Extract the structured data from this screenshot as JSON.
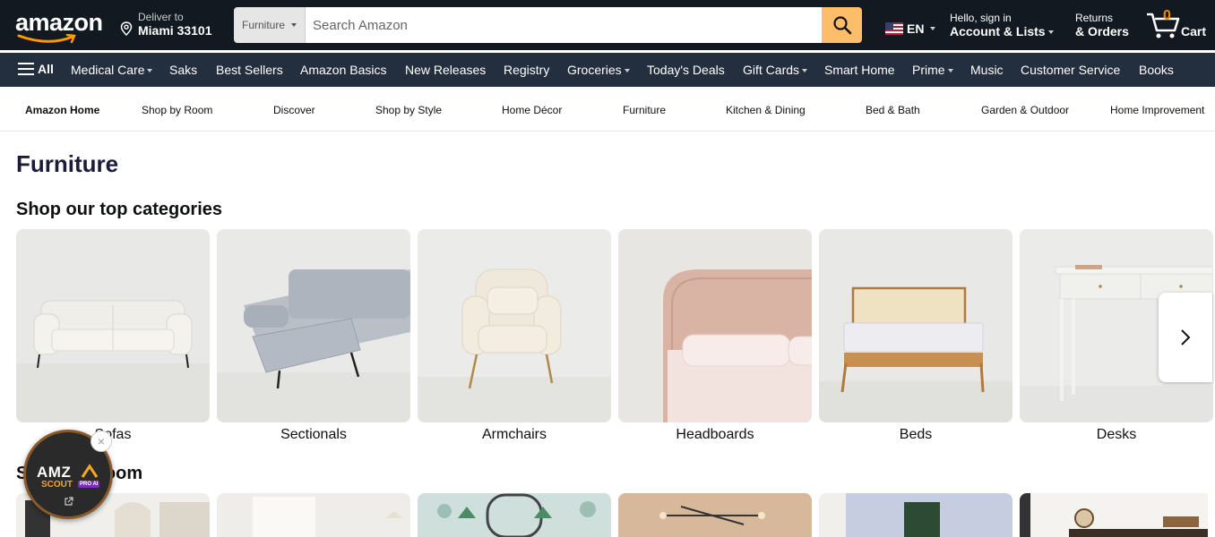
{
  "header": {
    "logo_text": "amazon",
    "deliver_line1": "Deliver to",
    "deliver_line2": "Miami 33101",
    "search_category": "Furniture",
    "search_placeholder": "Search Amazon",
    "language": "EN",
    "account_line1": "Hello, sign in",
    "account_line2": "Account & Lists",
    "returns_line1": "Returns",
    "returns_line2": "& Orders",
    "cart_count": "0",
    "cart_label": "Cart"
  },
  "nav": {
    "all_label": "All",
    "items": [
      "Medical Care",
      "Saks",
      "Best Sellers",
      "Amazon Basics",
      "New Releases",
      "Registry",
      "Groceries",
      "Today's Deals",
      "Gift Cards",
      "Smart Home",
      "Prime",
      "Music",
      "Customer Service",
      "Books"
    ]
  },
  "subnav": {
    "items": [
      "Amazon Home",
      "Shop by Room",
      "Discover",
      "Shop by Style",
      "Home Décor",
      "Furniture",
      "Kitchen & Dining",
      "Bed & Bath",
      "Garden & Outdoor",
      "Home Improvement"
    ]
  },
  "page": {
    "title": "Furniture",
    "categories_heading": "Shop our top categories",
    "room_heading": "Shop by Room"
  },
  "categories": [
    "Sofas",
    "Sectionals",
    "Armchairs",
    "Headboards",
    "Beds",
    "Desks"
  ],
  "widget": {
    "line1": "AMZ",
    "line2": "SCOUT",
    "badge": "PRO AI"
  },
  "colors": {
    "header_bg": "#131921",
    "nav_bg": "#232f3e",
    "search_button": "#febd69",
    "cart_count": "#f08804"
  }
}
